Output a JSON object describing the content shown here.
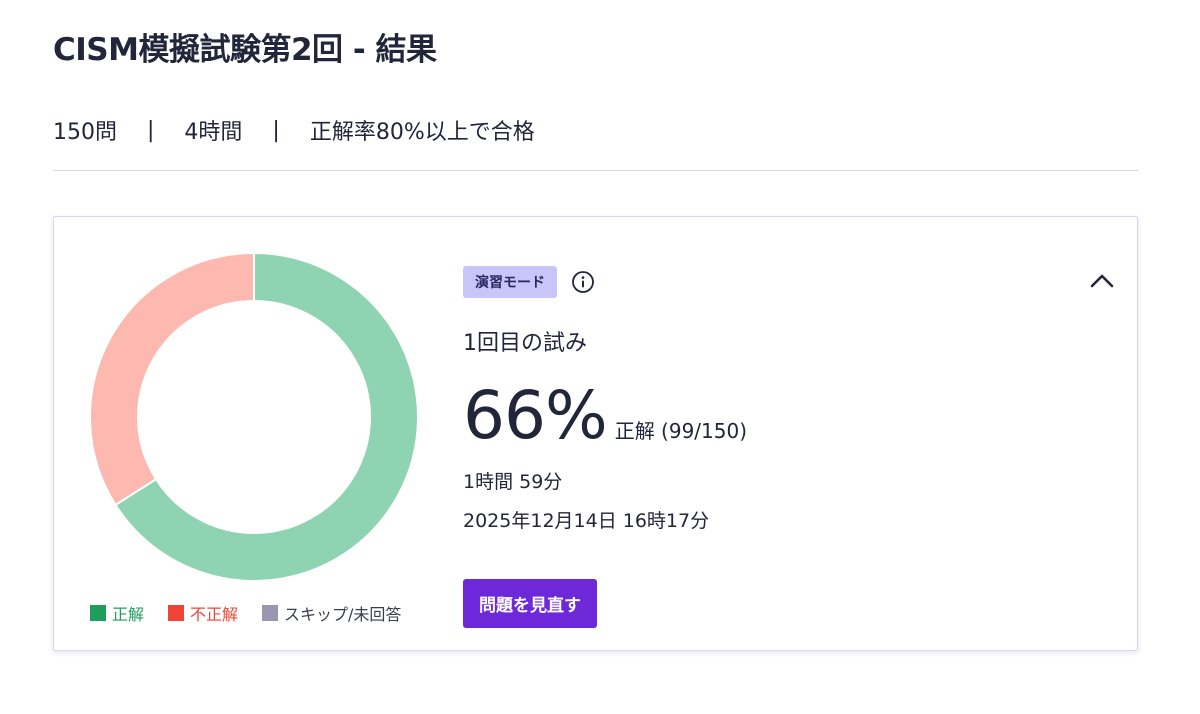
{
  "header": {
    "title": "CISM模擬試験第2回 - 結果",
    "question_count": "150問",
    "separator": "|",
    "duration_limit": "4時間",
    "pass_condition": "正解率80%以上で合格"
  },
  "result": {
    "mode_badge": "演習モード",
    "attempt_label": "1回目の試み",
    "score_percent": "66%",
    "score_detail": "正解 (99/150)",
    "elapsed_time": "1時間 59分",
    "completed_at": "2025年12月14日 16時17分",
    "review_button_label": "問題を見直す",
    "icons": {
      "info": "info-icon",
      "collapse": "chevron-up-icon"
    }
  },
  "chart_data": {
    "type": "pie",
    "series": [
      {
        "name": "正解",
        "value": 99,
        "color": "#8ed4b2",
        "legend_color": "#1f9d5c"
      },
      {
        "name": "不正解",
        "value": 51,
        "color": "#fdb8b0",
        "legend_color": "#f04438"
      },
      {
        "name": "スキップ/未回答",
        "value": 0,
        "color": "#9a98b0",
        "legend_color": "#9a98b0"
      }
    ],
    "total": 150
  }
}
